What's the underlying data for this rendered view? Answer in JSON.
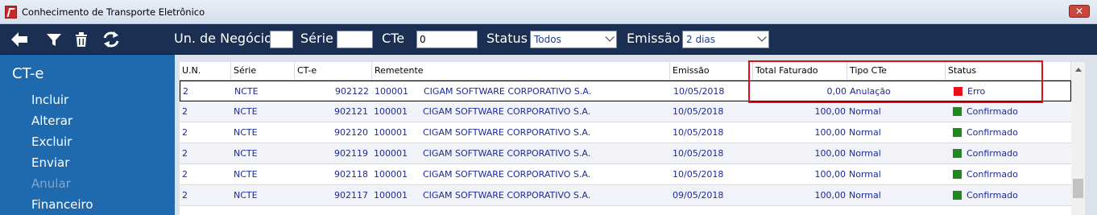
{
  "window": {
    "title": "Conhecimento de Transporte Eletrônico",
    "close_label": "✕"
  },
  "toolbar": {
    "icons": [
      "back-arrow-icon",
      "filter-icon",
      "trash-icon",
      "refresh-icon"
    ],
    "un_negocio_label": "Un. de Negócio",
    "un_negocio_value": "",
    "serie_label": "Série",
    "serie_value": "",
    "cte_label": "CTe",
    "cte_value": "0",
    "status_label": "Status",
    "status_value": "Todos",
    "emissao_label": "Emissão",
    "emissao_value": "2 dias"
  },
  "sidebar": {
    "title": "CT-e",
    "items": [
      {
        "label": "Incluir",
        "enabled": true
      },
      {
        "label": "Alterar",
        "enabled": true
      },
      {
        "label": "Excluir",
        "enabled": true
      },
      {
        "label": "Enviar",
        "enabled": true
      },
      {
        "label": "Anular",
        "enabled": false
      },
      {
        "label": "Financeiro",
        "enabled": true
      }
    ]
  },
  "table": {
    "headers": [
      "U.N.",
      "Série",
      "CT-e",
      "Remetente",
      "Emissão",
      "Total Faturado",
      "Tipo CTe",
      "Status"
    ],
    "rows": [
      {
        "un": "2",
        "serie": "NCTE",
        "cte": "902122",
        "rem_code": "100001",
        "rem_name": "CIGAM SOFTWARE CORPORATIVO S.A.",
        "emissao": "10/05/2018",
        "total": "0,00",
        "tipo": "Anulação",
        "status": "Erro",
        "status_color": "#e8101a"
      },
      {
        "un": "2",
        "serie": "NCTE",
        "cte": "902121",
        "rem_code": "100001",
        "rem_name": "CIGAM SOFTWARE CORPORATIVO S.A.",
        "emissao": "10/05/2018",
        "total": "100,00",
        "tipo": "Normal",
        "status": "Confirmado",
        "status_color": "#1e8a1e"
      },
      {
        "un": "2",
        "serie": "NCTE",
        "cte": "902120",
        "rem_code": "100001",
        "rem_name": "CIGAM SOFTWARE CORPORATIVO S.A.",
        "emissao": "10/05/2018",
        "total": "100,00",
        "tipo": "Normal",
        "status": "Confirmado",
        "status_color": "#1e8a1e"
      },
      {
        "un": "2",
        "serie": "NCTE",
        "cte": "902119",
        "rem_code": "100001",
        "rem_name": "CIGAM SOFTWARE CORPORATIVO S.A.",
        "emissao": "10/05/2018",
        "total": "100,00",
        "tipo": "Normal",
        "status": "Confirmado",
        "status_color": "#1e8a1e"
      },
      {
        "un": "2",
        "serie": "NCTE",
        "cte": "902118",
        "rem_code": "100001",
        "rem_name": "CIGAM SOFTWARE CORPORATIVO S.A.",
        "emissao": "10/05/2018",
        "total": "100,00",
        "tipo": "Normal",
        "status": "Confirmado",
        "status_color": "#1e8a1e"
      },
      {
        "un": "2",
        "serie": "NCTE",
        "cte": "902117",
        "rem_code": "100001",
        "rem_name": "CIGAM SOFTWARE CORPORATIVO S.A.",
        "emissao": "09/05/2018",
        "total": "100,00",
        "tipo": "Normal",
        "status": "Confirmado",
        "status_color": "#1e8a1e"
      }
    ]
  },
  "colors": {
    "toolbar_bg": "#1b2f52",
    "sidebar_bg": "#1f6aaf",
    "highlight": "#e0101a"
  }
}
